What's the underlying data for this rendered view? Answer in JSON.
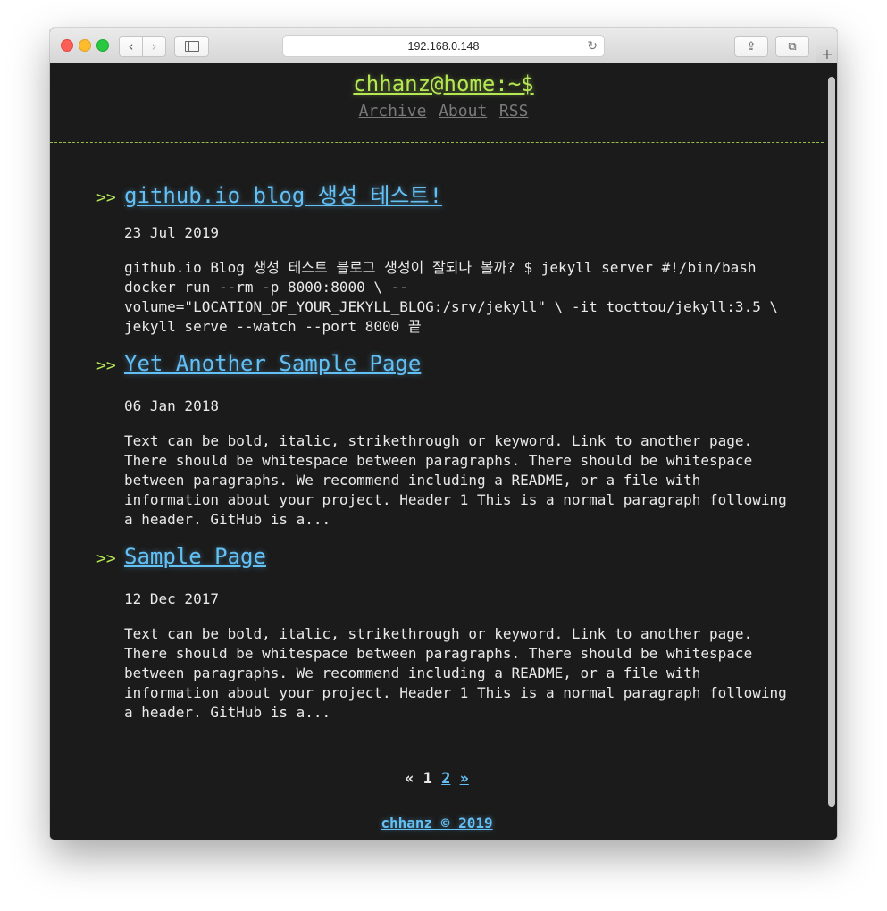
{
  "browser": {
    "url": "192.168.0.148",
    "back_glyph": "‹",
    "forward_glyph": "›",
    "reload_glyph": "↻",
    "share_glyph": "⇪",
    "tabs_glyph": "⧉",
    "newtab_glyph": "+"
  },
  "site": {
    "title": "chhanz@home:~$",
    "nav": [
      "Archive",
      "About",
      "RSS"
    ]
  },
  "posts": [
    {
      "arrow": ">>",
      "title": "github.io blog 생성 테스트!",
      "date": "23 Jul 2019",
      "excerpt": "github.io Blog 생성 테스트 블로그 생성이 잘되나 볼까? $ jekyll server #!/bin/bash docker run --rm -p 8000:8000 \\ --volume=\"LOCATION_OF_YOUR_JEKYLL_BLOG:/srv/jekyll\" \\ -it tocttou/jekyll:3.5 \\ jekyll serve --watch --port 8000 끝"
    },
    {
      "arrow": ">>",
      "title": "Yet Another Sample Page",
      "date": "06 Jan 2018",
      "excerpt": "Text can be bold, italic, strikethrough or keyword. Link to another page. There should be whitespace between paragraphs. There should be whitespace between paragraphs. We recommend including a README, or a file with information about your project. Header 1 This is a normal paragraph following a header. GitHub is a..."
    },
    {
      "arrow": ">>",
      "title": "Sample Page",
      "date": "12 Dec 2017",
      "excerpt": "Text can be bold, italic, strikethrough or keyword. Link to another page. There should be whitespace between paragraphs. There should be whitespace between paragraphs. We recommend including a README, or a file with information about your project. Header 1 This is a normal paragraph following a header. GitHub is a..."
    }
  ],
  "pagination": {
    "prev": "«",
    "current": "1",
    "next_page": "2",
    "next": "»"
  },
  "footer": {
    "text": "chhanz © 2019"
  },
  "colors": {
    "background": "#1b1b1b",
    "accent_green": "#b5e853",
    "link_blue": "#63c0f5",
    "text": "#eaeaea",
    "muted_nav": "#7a7a7a"
  }
}
